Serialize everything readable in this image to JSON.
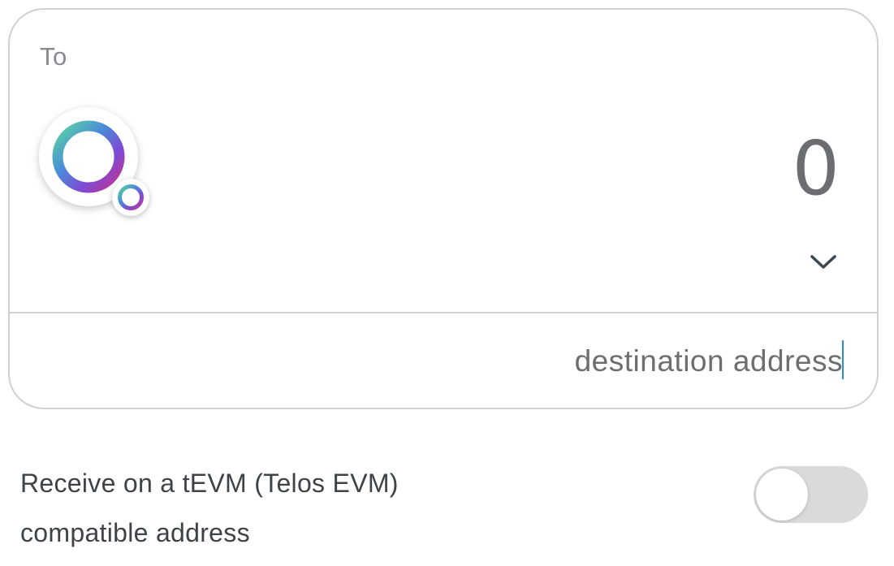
{
  "card": {
    "label": "To",
    "token": {
      "icon": "telos-ring-icon",
      "badge_icon": "telos-network-icon"
    },
    "amount": "0",
    "address_placeholder": "destination address"
  },
  "evm_option": {
    "label": "Receive on a tEVM (Telos EVM) compatible address",
    "enabled": false
  },
  "colors": {
    "ring_gradient": [
      "#5ad6a0",
      "#4a8cd8",
      "#7d4bd4",
      "#c2338f"
    ],
    "border": "#cfd0d3",
    "toggle_off": "#d9dadb",
    "caret": "#2a8bd6"
  }
}
